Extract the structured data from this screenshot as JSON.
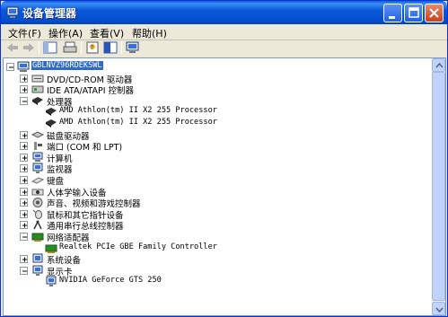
{
  "window": {
    "title": "设备管理器"
  },
  "menu": [
    "文件(F)",
    "操作(A)",
    "查看(V)",
    "帮助(H)"
  ],
  "tree": {
    "root": "GBLNVZ96RDEKSWL",
    "nodes": [
      {
        "label": "DVD/CD-ROM 驱动器",
        "icon": "cdrom-icon",
        "expanded": false,
        "children": []
      },
      {
        "label": "IDE ATA/ATAPI 控制器",
        "icon": "ide-controller-icon",
        "expanded": false,
        "children": []
      },
      {
        "label": "处理器",
        "icon": "processor-icon",
        "expanded": true,
        "children": [
          "AMD Athlon(tm) II X2 255 Processor",
          "AMD Athlon(tm) II X2 255 Processor"
        ]
      },
      {
        "label": "磁盘驱动器",
        "icon": "disk-drive-icon",
        "expanded": false,
        "children": []
      },
      {
        "label": "端口 (COM 和 LPT)",
        "icon": "port-icon",
        "expanded": false,
        "children": []
      },
      {
        "label": "计算机",
        "icon": "computer-icon",
        "expanded": false,
        "children": []
      },
      {
        "label": "监视器",
        "icon": "monitor-icon",
        "expanded": false,
        "children": []
      },
      {
        "label": "键盘",
        "icon": "keyboard-icon",
        "expanded": false,
        "children": []
      },
      {
        "label": "人体学输入设备",
        "icon": "hid-icon",
        "expanded": false,
        "children": []
      },
      {
        "label": "声音、视频和游戏控制器",
        "icon": "sound-icon",
        "expanded": false,
        "children": []
      },
      {
        "label": "鼠标和其它指针设备",
        "icon": "mouse-icon",
        "expanded": false,
        "children": []
      },
      {
        "label": "通用串行总线控制器",
        "icon": "usb-icon",
        "expanded": false,
        "children": []
      },
      {
        "label": "网络适配器",
        "icon": "network-adapter-icon",
        "expanded": true,
        "children": [
          "Realtek PCIe GBE Family Controller"
        ]
      },
      {
        "label": "系统设备",
        "icon": "system-device-icon",
        "expanded": false,
        "children": []
      },
      {
        "label": "显示卡",
        "icon": "display-adapter-icon",
        "expanded": true,
        "children": [
          "NVIDIA GeForce GTS 250"
        ]
      }
    ]
  }
}
